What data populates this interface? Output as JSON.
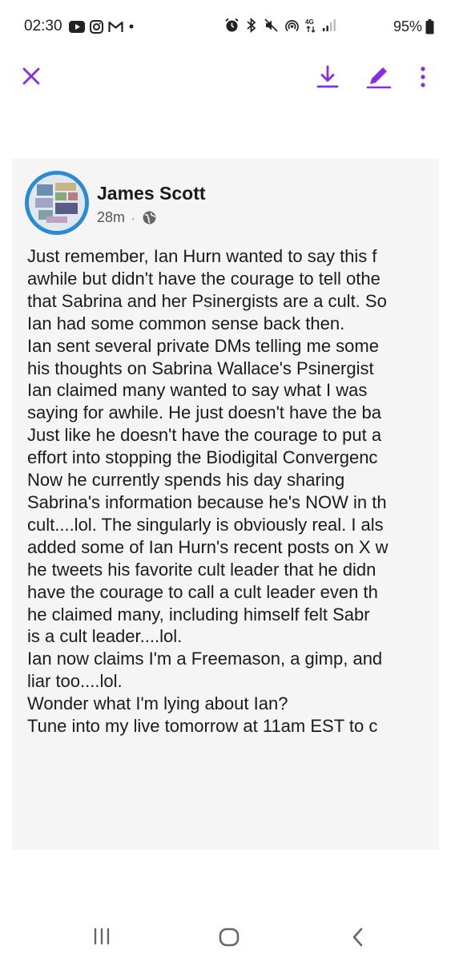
{
  "status_bar": {
    "time": "02:30",
    "battery": "95%",
    "left_icons": [
      "youtube-icon",
      "instagram-icon",
      "gmail-icon",
      "dot-icon"
    ],
    "right_icons": [
      "alarm-icon",
      "bluetooth-icon",
      "mute-icon",
      "hotspot-icon",
      "4g-icon",
      "signal-icon",
      "battery-icon"
    ]
  },
  "toolbar": {
    "accent_color": "#8a2be2",
    "icons": [
      "close-icon",
      "download-icon",
      "edit-icon",
      "more-vertical-icon"
    ]
  },
  "post": {
    "author": "James Scott",
    "time": "28m",
    "visibility_icon": "globe-icon",
    "lines": [
      "Just remember, Ian Hurn wanted to say this f",
      "awhile but didn't have the courage to tell othe",
      "that Sabrina and her Psinergists are a cult. So",
      "Ian had some common sense back then.",
      "Ian sent several private DMs telling me some",
      "his thoughts on Sabrina Wallace's Psinergist",
      "Ian claimed many wanted to say what I was",
      "saying for awhile. He just doesn't have the ba",
      "Just like he doesn't have the courage to put a",
      "effort into stopping the Biodigital Convergenc",
      "Now he currently spends his day sharing",
      "Sabrina's information because he's NOW in th",
      "cult....lol. The singularly is obviously real. I als",
      "added some of Ian Hurn's recent posts on X w",
      "he  tweets his favorite cult leader that he didn",
      "have the courage to call a cult leader even th",
      "he claimed many, including himself felt  Sabr",
      "is a cult leader....lol.",
      "Ian now claims I'm a Freemason, a gimp, and",
      "liar too....lol.",
      "Wonder what I'm lying about Ian?",
      "Tune into my live tomorrow at 11am EST to c"
    ]
  },
  "nav_bar": {
    "icons": [
      "recents-icon",
      "home-icon",
      "back-icon"
    ]
  }
}
